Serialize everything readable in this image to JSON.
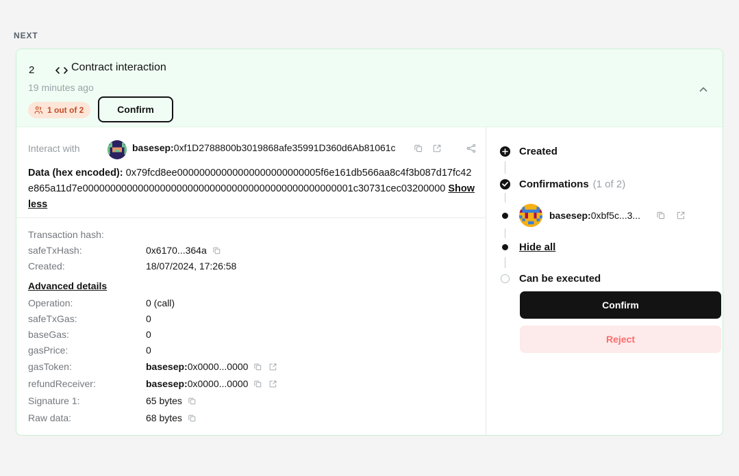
{
  "section": {
    "label": "NEXT"
  },
  "transaction": {
    "index": "2",
    "type": "Contract interaction",
    "time": "19 minutes ago",
    "confirmations_badge": "1 out of 2",
    "header_confirm_label": "Confirm",
    "interact_with_label": "Interact with",
    "interact_with_prefix": "basesep:",
    "interact_with_address": "0xf1D2788800b3019868afe35991D360d6Ab81061c",
    "data_label": "Data (hex encoded):",
    "data_hex": "0x79fcd8ee00000000000000000000000005f6e161db566aa8c4f3b087d17fc42e865a11d7e0000000000000000000000000000000000000000000000001c30731cec03200000",
    "show_less_label": "Show less"
  },
  "details": {
    "transaction_hash_label": "Transaction hash:",
    "transaction_hash_value": "",
    "advanced_title": "Advanced details",
    "rows": [
      {
        "key": "safeTxHash:",
        "value": "0x6170...364a",
        "copy": true,
        "link": false,
        "prefix": ""
      },
      {
        "key": "Created:",
        "value": "18/07/2024, 17:26:58",
        "copy": false,
        "link": false,
        "prefix": ""
      },
      {
        "key": "Operation:",
        "value": "0 (call)",
        "copy": false,
        "link": false,
        "prefix": ""
      },
      {
        "key": "safeTxGas:",
        "value": "0",
        "copy": false,
        "link": false,
        "prefix": ""
      },
      {
        "key": "baseGas:",
        "value": "0",
        "copy": false,
        "link": false,
        "prefix": ""
      },
      {
        "key": "gasPrice:",
        "value": "0",
        "copy": false,
        "link": false,
        "prefix": ""
      },
      {
        "key": "gasToken:",
        "value": "0x0000...0000",
        "copy": true,
        "link": true,
        "prefix": "basesep:"
      },
      {
        "key": "refundReceiver:",
        "value": "0x0000...0000",
        "copy": true,
        "link": true,
        "prefix": "basesep:"
      },
      {
        "key": "Signature 1:",
        "value": "65 bytes",
        "copy": true,
        "link": false,
        "prefix": ""
      },
      {
        "key": "Raw data:",
        "value": "68 bytes",
        "copy": true,
        "link": false,
        "prefix": ""
      }
    ]
  },
  "timeline": {
    "created_label": "Created",
    "confirmations_label": "Confirmations",
    "confirmations_count": "(1 of 2)",
    "confirmer_prefix": "basesep:",
    "confirmer_address": "0xbf5c...3...",
    "hide_all_label": "Hide all",
    "can_execute_label": "Can be executed"
  },
  "actions": {
    "confirm_label": "Confirm",
    "reject_label": "Reject"
  },
  "colors": {
    "header_bg": "#f0fdf4",
    "card_border": "#c9eed6",
    "badge_bg": "#fde6d8",
    "badge_text": "#c04b26",
    "confirm_bg": "#121312",
    "reject_bg": "#fdeaea",
    "reject_text": "#ff6c6c"
  }
}
